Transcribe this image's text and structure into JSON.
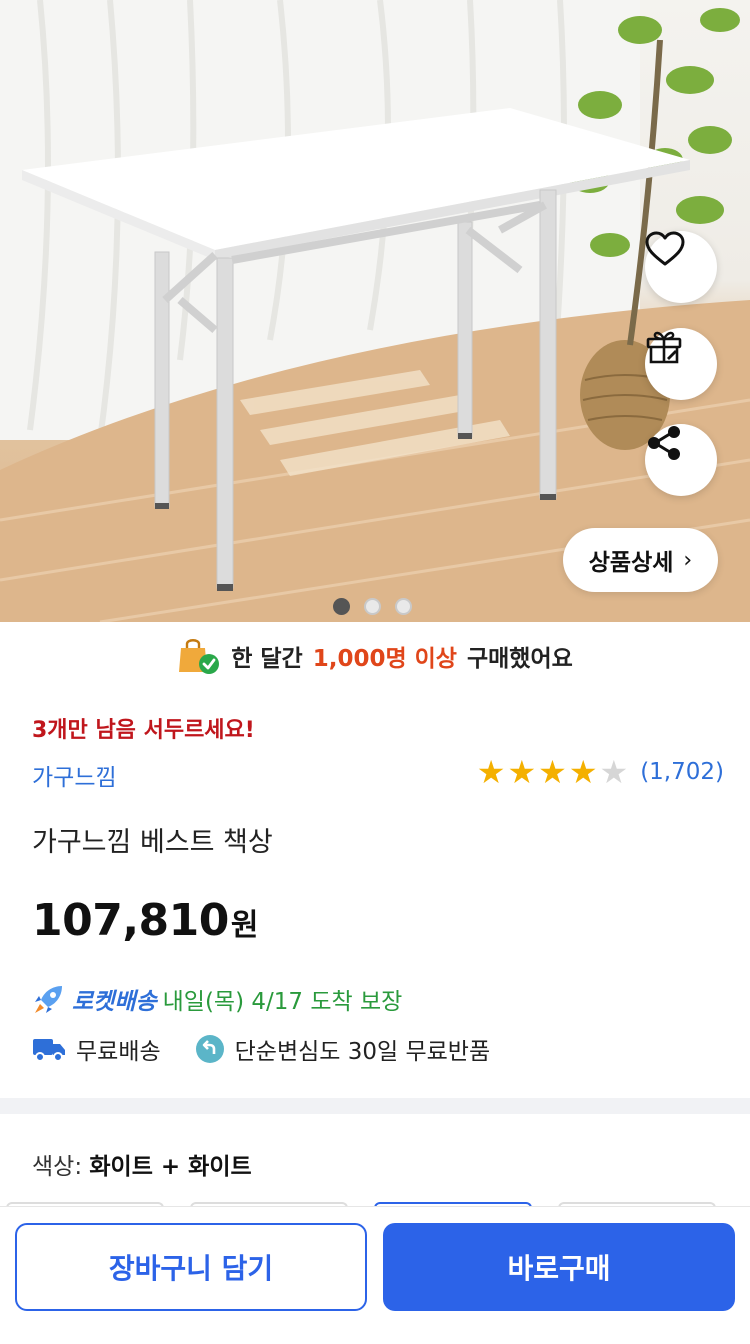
{
  "hero": {
    "detail_label": "상품상세",
    "detail_chevron": "›",
    "image_count": 3,
    "active_image": 1,
    "icons": [
      "heart-icon",
      "gift-icon",
      "share-icon"
    ]
  },
  "banner": {
    "prefix": "한 달간",
    "highlight": "1,000명 이상",
    "suffix": "구매했어요",
    "icon": "shopping-bag-check-icon"
  },
  "product": {
    "stock_alert": "3개만 남음 서두르세요!",
    "brand": "가구느낌",
    "rating_stars": 4,
    "rating_max": 5,
    "review_count": "(1,702)",
    "name": "가구느낌 베스트 책상",
    "price": "107,810",
    "currency": "원"
  },
  "delivery": {
    "rocket_label": "로켓배송",
    "eta": "내일(목) 4/17 도착 보장",
    "free_shipping": "무료배송",
    "free_return": "단순변심도 30일 무료반품"
  },
  "option": {
    "label": "색상:",
    "value": "화이트 + 화이트"
  },
  "actions": {
    "cart": "장바구니 담기",
    "buy": "바로구매"
  },
  "colors": {
    "accent": "#2c63e8",
    "link": "#2e6fd8",
    "alert": "#c0161c",
    "highlight": "#e0461a",
    "eta_green": "#2a9a3c",
    "star": "#f4b000"
  }
}
